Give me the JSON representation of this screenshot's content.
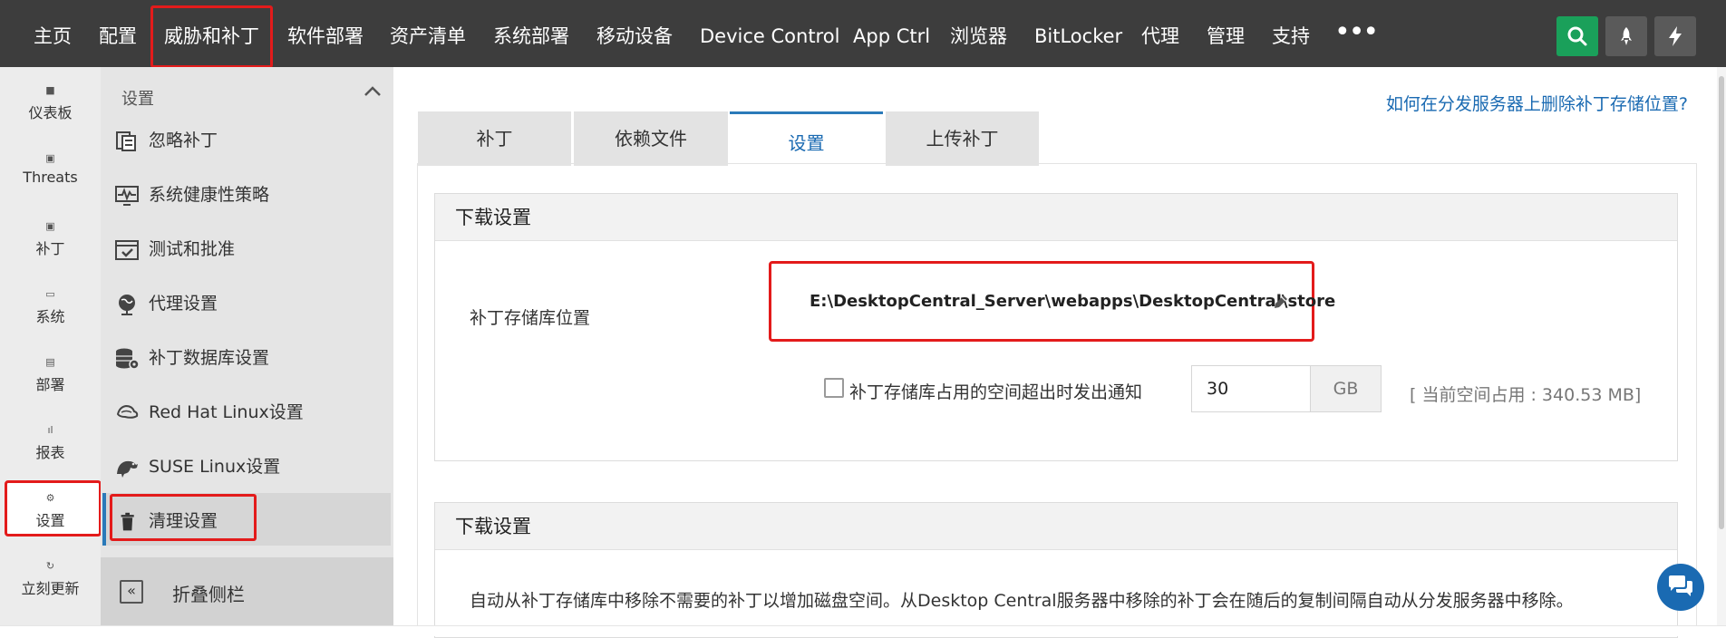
{
  "topnav": {
    "items": [
      "主页",
      "配置",
      "威胁和补丁",
      "软件部署",
      "资产清单",
      "系统部署",
      "移动设备",
      "Device Control",
      "App Ctrl",
      "浏览器",
      "BitLocker",
      "代理",
      "管理",
      "支持"
    ],
    "more_icon": "more-dots-icon",
    "buttons": [
      "search-icon",
      "rocket-icon",
      "lightning-icon"
    ],
    "search_color": "#1aa05a"
  },
  "rail": {
    "items": [
      {
        "label": "仪表板",
        "icon": "dashboard-icon"
      },
      {
        "label": "Threats",
        "icon": "threats-icon"
      },
      {
        "label": "补丁",
        "icon": "patch-icon"
      },
      {
        "label": "系统",
        "icon": "system-icon"
      },
      {
        "label": "部署",
        "icon": "deploy-icon"
      },
      {
        "label": "报表",
        "icon": "report-icon"
      },
      {
        "label": "设置",
        "icon": "gear-icon"
      },
      {
        "label": "立刻更新",
        "icon": "refresh-icon"
      }
    ]
  },
  "submenu": {
    "header": "设置",
    "items": [
      {
        "label": "忽略补丁",
        "icon": "ignore-patch-icon"
      },
      {
        "label": "系统健康性策略",
        "icon": "health-monitor-icon"
      },
      {
        "label": "测试和批准",
        "icon": "approve-icon"
      },
      {
        "label": "代理设置",
        "icon": "proxy-globe-icon"
      },
      {
        "label": "补丁数据库设置",
        "icon": "database-gear-icon"
      },
      {
        "label": "Red Hat Linux设置",
        "icon": "redhat-icon"
      },
      {
        "label": "SUSE Linux设置",
        "icon": "suse-icon"
      },
      {
        "label": "清理设置",
        "icon": "trash-icon"
      }
    ],
    "collapse_label": "折叠侧栏"
  },
  "main": {
    "help_link": "如何在分发服务器上删除补丁存储位置?",
    "tabs": [
      "补丁",
      "依赖文件",
      "设置",
      "上传补丁"
    ],
    "active_tab": "设置",
    "section1": {
      "title": "下载设置",
      "field_label": "补丁存储库位置",
      "path": "E:\\DesktopCentral_Server\\webapps\\DesktopCentral\\store",
      "checkbox_label": "补丁存储库占用的空间超出时发出通知",
      "checkbox_checked": false,
      "threshold_value": "30",
      "threshold_unit": "GB",
      "usage_text": "[ 当前空间占用 : 340.53 MB]"
    },
    "section2": {
      "title": "下载设置",
      "description": "自动从补丁存储库中移除不需要的补丁以增加磁盘空间。从Desktop Central服务器中移除的补丁会在随后的复制间隔自动从分发服务器中移除。"
    }
  },
  "colors": {
    "nav_bg": "#3d3d3d",
    "highlight": "#e31b1b",
    "link": "#1a6ab2"
  }
}
